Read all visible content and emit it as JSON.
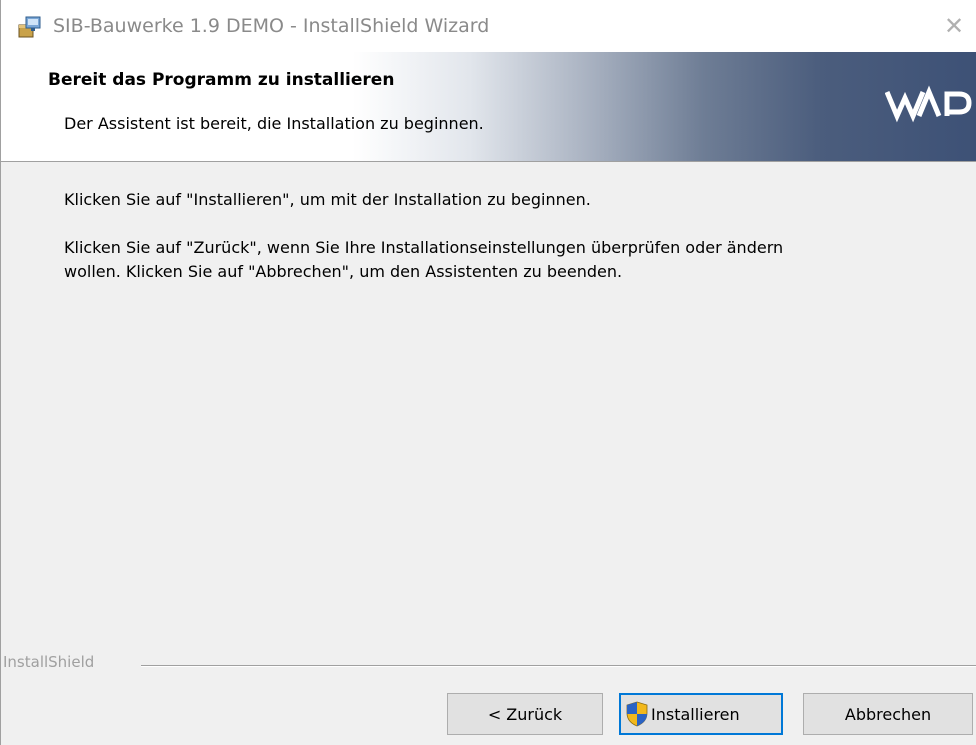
{
  "window": {
    "title": "SIB-Bauwerke 1.9 DEMO - InstallShield Wizard",
    "close_glyph": "✕",
    "app_icon": "installer-package-icon"
  },
  "banner": {
    "title": "Bereit das Programm zu installieren",
    "subtitle": "Der Assistent ist bereit, die Installation zu beginnen.",
    "logo": "wp-logo"
  },
  "content": {
    "paragraph1": "Klicken Sie auf \"Installieren\", um mit der Installation zu beginnen.",
    "paragraph2_line1": "Klicken Sie auf \"Zurück\", wenn Sie Ihre Installationseinstellungen überprüfen oder ändern",
    "paragraph2_line2": "wollen. Klicken Sie auf \"Abbrechen\", um den Assistenten zu beenden."
  },
  "footer": {
    "brand_label": "InstallShield"
  },
  "buttons": {
    "back_label": "< Zurück",
    "install_label": "Installieren",
    "install_icon": "uac-shield-icon",
    "cancel_label": "Abbrechen"
  },
  "colors": {
    "background": "#f0f0f0",
    "focus_border": "#0078d7",
    "banner_dark": "#3d5176"
  }
}
